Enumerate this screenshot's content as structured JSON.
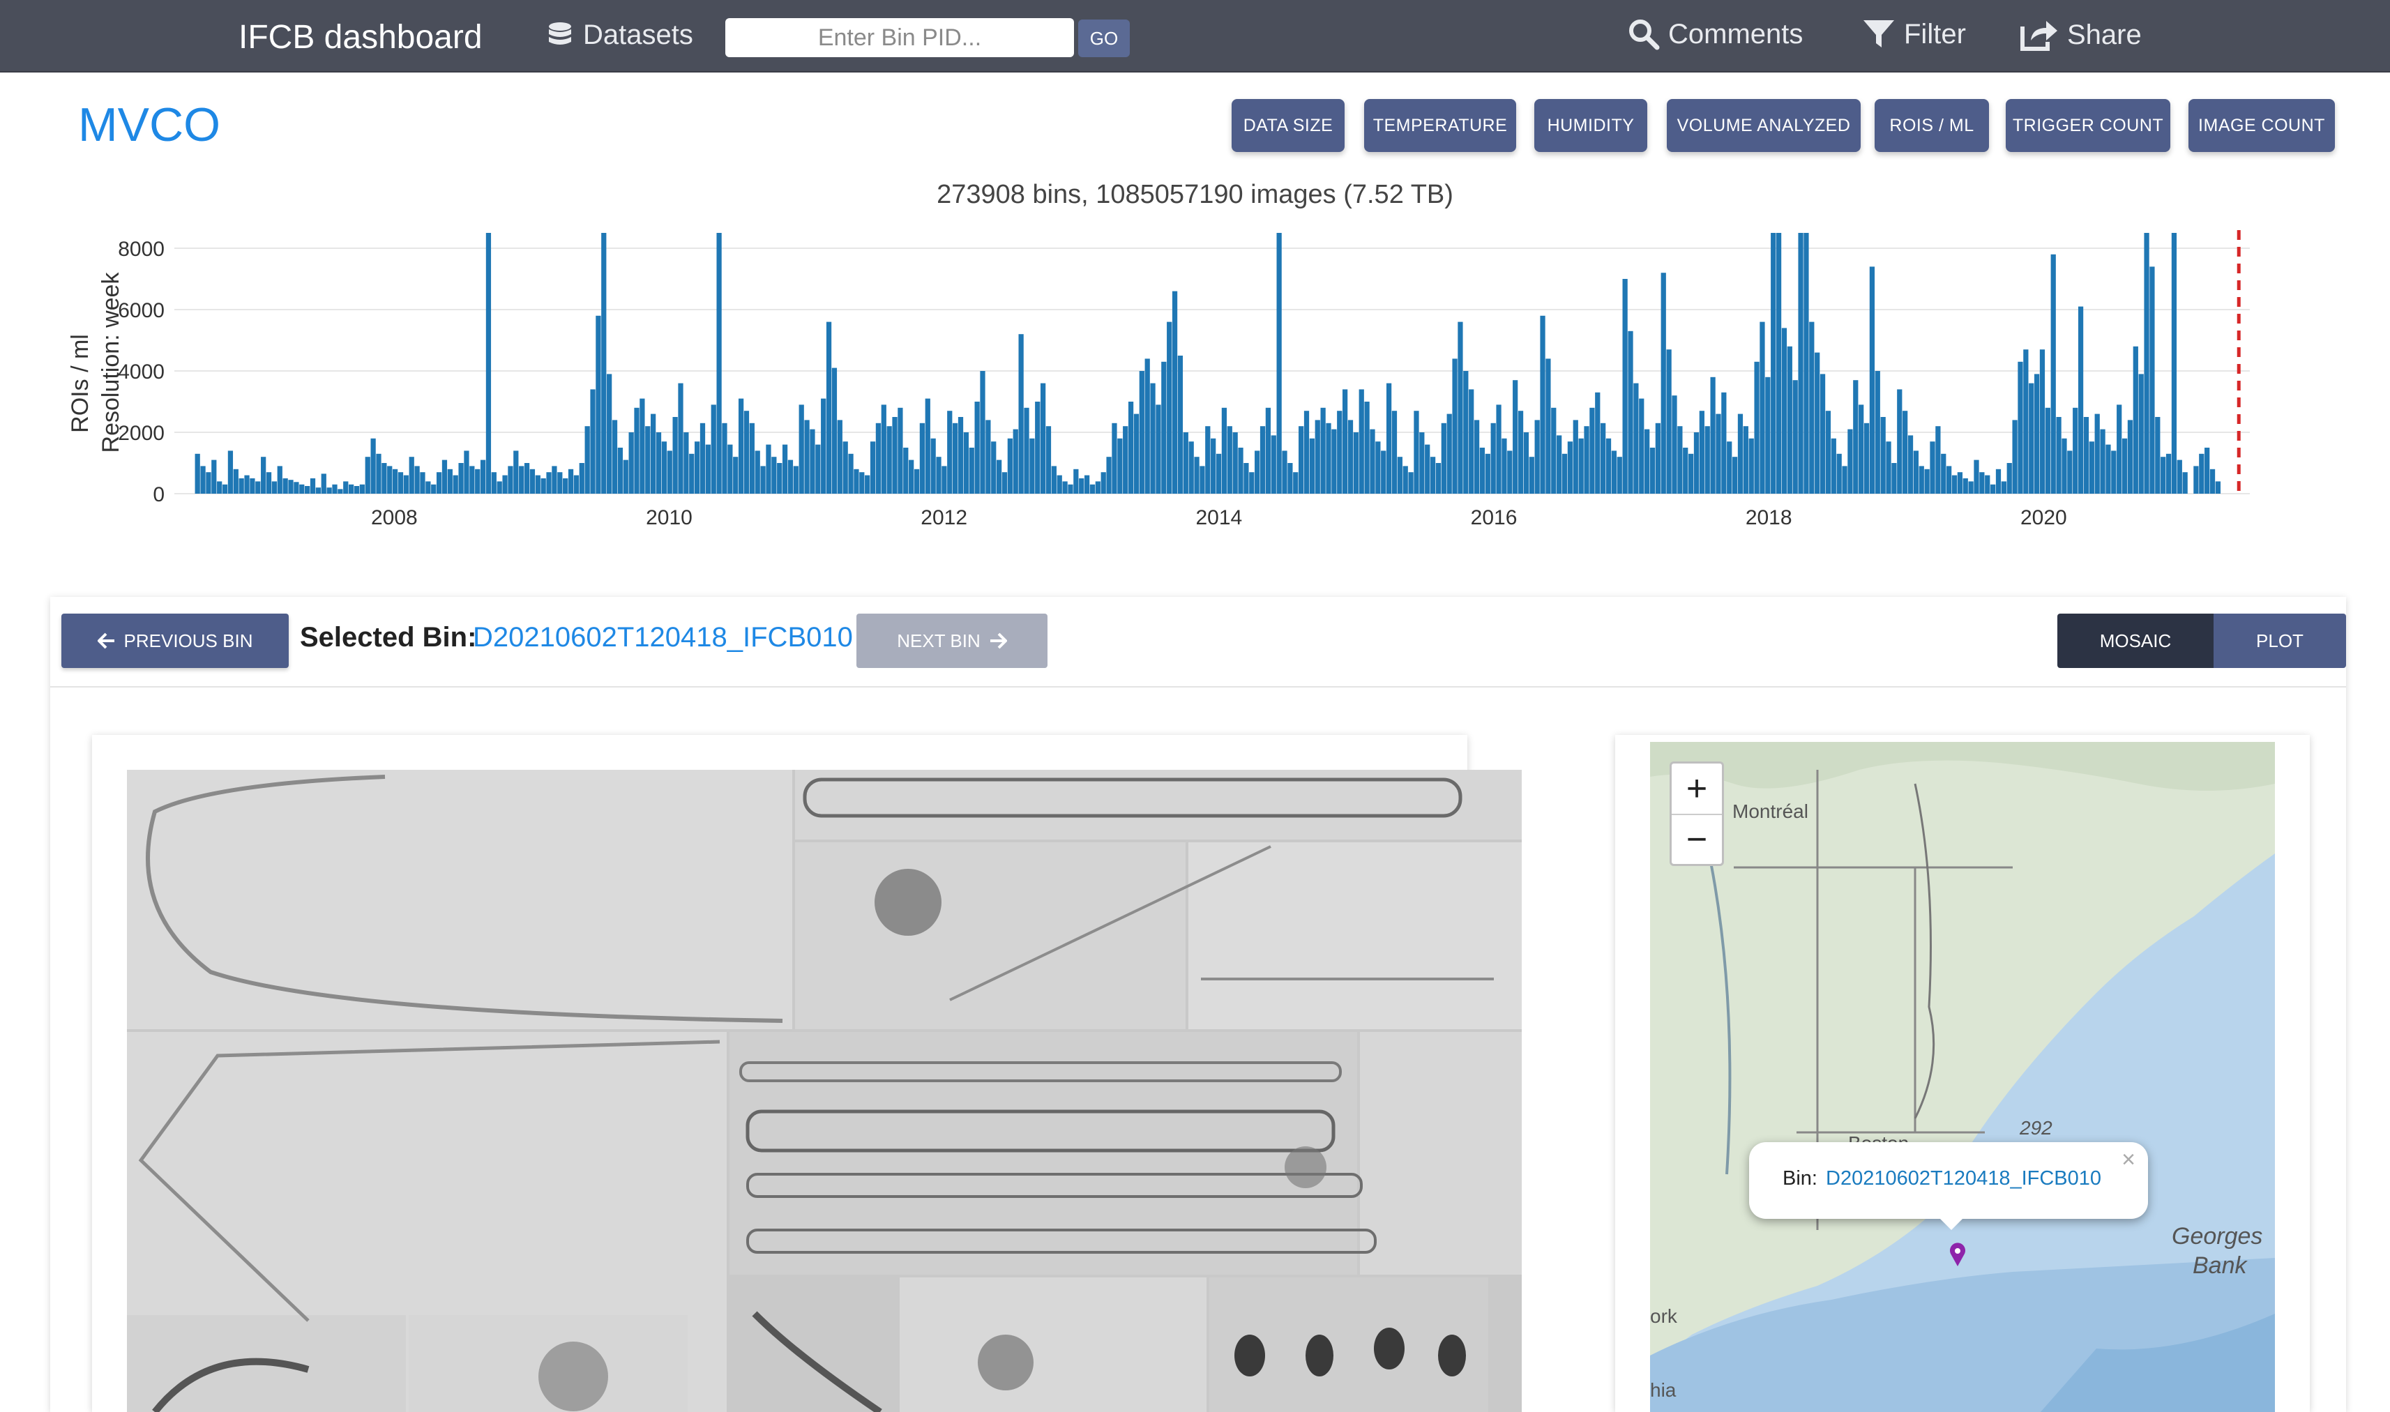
{
  "navbar": {
    "brand": "IFCB dashboard",
    "datasets_label": "Datasets",
    "pid_placeholder": "Enter Bin PID...",
    "go_label": "GO",
    "comments_label": "Comments",
    "filter_label": "Filter",
    "share_label": "Share"
  },
  "dataset": {
    "title": "MVCO"
  },
  "metric_buttons": [
    "DATA SIZE",
    "TEMPERATURE",
    "HUMIDITY",
    "VOLUME ANALYZED",
    "ROIS / ML",
    "TRIGGER COUNT",
    "IMAGE COUNT"
  ],
  "chart_data": {
    "type": "bar",
    "title": "273908 bins, 1085057190 images (7.52 TB)",
    "ylabel": "ROIs / ml",
    "ylabel2": "Resolution: week",
    "ylim": [
      0,
      8500
    ],
    "xlim": [
      2006.4,
      2021.5
    ],
    "yticks": [
      0,
      2000,
      4000,
      6000,
      8000
    ],
    "xticks": [
      2008,
      2010,
      2012,
      2014,
      2016,
      2018,
      2020
    ],
    "bar_color": "#1f77b4",
    "marker_line_x": 2021.42,
    "marker_color": "#d62728",
    "weekly_values_2007_2021": [
      1300,
      900,
      700,
      1100,
      400,
      300,
      1400,
      800,
      500,
      600,
      500,
      400,
      1200,
      700,
      400,
      900,
      500,
      450,
      380,
      300,
      250,
      500,
      200,
      650,
      200,
      300,
      150,
      400,
      300,
      250,
      300,
      1200,
      1800,
      1300,
      1000,
      900,
      800,
      700,
      600,
      1200,
      900,
      700,
      400,
      300,
      700,
      1100,
      800,
      600,
      1000,
      1400,
      900,
      800,
      1100,
      8500,
      700,
      400,
      600,
      900,
      1400,
      900,
      1000,
      800,
      600,
      500,
      700,
      900,
      700,
      500,
      800,
      600,
      1000,
      2200,
      3400,
      5800,
      8500,
      3900,
      2400,
      1500,
      1100,
      2000,
      2800,
      3100,
      2200,
      2600,
      2000,
      1700,
      1400,
      2500,
      3600,
      2000,
      1300,
      1700,
      2300,
      1600,
      2900,
      8500,
      2300,
      1600,
      1200,
      3100,
      2700,
      2300,
      1400,
      900,
      1600,
      1200,
      1000,
      1600,
      1100,
      900,
      2900,
      2400,
      2100,
      1600,
      3100,
      5600,
      4100,
      2400,
      1700,
      1300,
      800,
      700,
      600,
      1700,
      2300,
      2900,
      2200,
      2500,
      2800,
      1500,
      1100,
      800,
      2300,
      3100,
      1800,
      1200,
      900,
      2700,
      2300,
      2500,
      2000,
      1500,
      3000,
      4000,
      2400,
      1700,
      1100,
      700,
      1800,
      2100,
      5200,
      2800,
      1800,
      3000,
      3600,
      2200,
      900,
      600,
      400,
      300,
      800,
      500,
      600,
      300,
      400,
      700,
      1200,
      2300,
      1800,
      2200,
      3000,
      2600,
      4000,
      4400,
      3600,
      2900,
      4300,
      5600,
      6600,
      4500,
      2000,
      1700,
      1200,
      900,
      2200,
      1800,
      1300,
      2800,
      2200,
      2000,
      1500,
      1000,
      700,
      1400,
      2200,
      2800,
      1900,
      8500,
      1400,
      1000,
      700,
      2200,
      2700,
      1800,
      2400,
      2800,
      2300,
      2100,
      2700,
      3400,
      2400,
      2000,
      3400,
      3000,
      2100,
      1700,
      1400,
      3600,
      2700,
      1200,
      900,
      700,
      2700,
      2000,
      1600,
      1200,
      1000,
      2300,
      2600,
      4400,
      5600,
      4000,
      3400,
      2400,
      1500,
      1300,
      2300,
      2900,
      1800,
      1400,
      3700,
      2700,
      2000,
      1200,
      2400,
      5800,
      4400,
      2800,
      1900,
      1300,
      1700,
      2400,
      1800,
      2200,
      2800,
      3300,
      2300,
      1800,
      1400,
      1200,
      7000,
      5300,
      3600,
      3100,
      2100,
      1500,
      2300,
      7200,
      4700,
      3200,
      2200,
      1500,
      1300,
      2000,
      2700,
      2200,
      3800,
      2600,
      3300,
      1700,
      1200,
      2600,
      2200,
      1800,
      4300,
      5600,
      3800,
      8500,
      8500,
      5400,
      4800,
      3700,
      8500,
      8500,
      5600,
      4600,
      3900,
      2700,
      1800,
      1300,
      900,
      2100,
      3700,
      2900,
      2300,
      7400,
      4000,
      2500,
      1700,
      1000,
      3400,
      2700,
      1900,
      1400,
      900,
      800,
      1700,
      2200,
      1300,
      900,
      600,
      700,
      500,
      400,
      1100,
      700,
      600,
      300,
      800,
      400,
      1000,
      2400,
      4300,
      4700,
      3600,
      3900,
      4700,
      2800,
      7800,
      2500,
      1800,
      1400,
      2800,
      6100,
      2500,
      1700,
      2600,
      2100,
      1600,
      1400,
      2900,
      1800,
      2400,
      4800,
      3900,
      8500,
      7400,
      2500,
      1200,
      1300,
      8500,
      1100,
      700,
      0,
      900,
      1300,
      1500,
      800,
      400,
      0,
      0,
      0,
      0
    ]
  },
  "bin_panel": {
    "prev_label": "PREVIOUS BIN",
    "selected_label": "Selected Bin:",
    "selected_pid": "D20210602T120418_IFCB010",
    "next_label": "NEXT BIN",
    "mosaic_label": "MOSAIC",
    "plot_label": "PLOT"
  },
  "map": {
    "zoom_in": "+",
    "zoom_out": "−",
    "popup_label": "Bin:",
    "popup_pid": "D20210602T120418_IFCB010",
    "popup_close": "×",
    "labels": {
      "montreal": "Montréal",
      "boston": "Boston",
      "depth": "292",
      "georges": "Georges",
      "bank": "Bank",
      "york": "ork",
      "phila": "hia"
    },
    "land_color": "#dce6d4",
    "water_color": "#b8d4ec",
    "marker_color": "#8e24aa"
  },
  "colors": {
    "navbar": "#4a4e5a",
    "button": "#4e5d8a",
    "accent": "#1e88e5"
  }
}
